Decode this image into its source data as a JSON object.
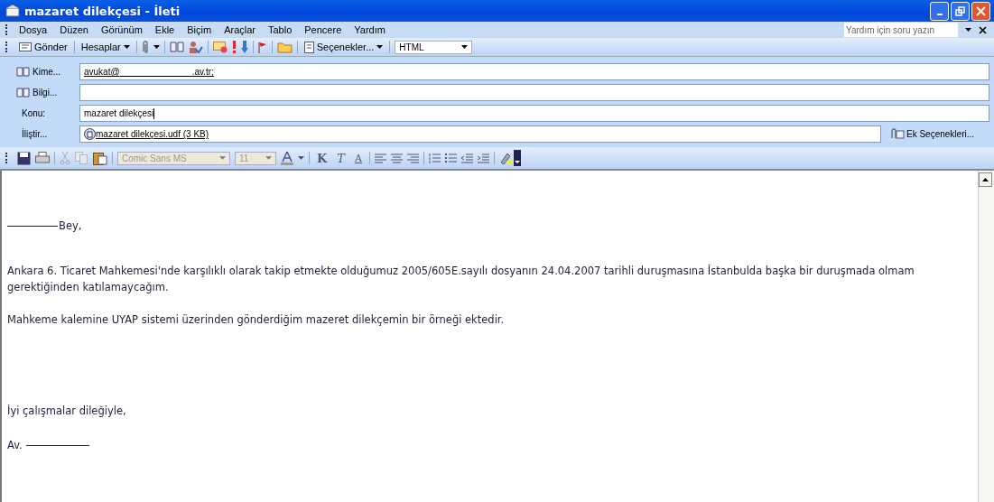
{
  "window": {
    "title": "mazaret dilekçesi - İleti"
  },
  "menu": [
    {
      "label": "Dosya"
    },
    {
      "label": "Düzen"
    },
    {
      "label": "Görünüm"
    },
    {
      "label": "Ekle"
    },
    {
      "label": "Biçim"
    },
    {
      "label": "Araçlar"
    },
    {
      "label": "Tablo"
    },
    {
      "label": "Pencere"
    },
    {
      "label": "Yardım"
    }
  ],
  "help_search": {
    "placeholder": "Yardım için soru yazın"
  },
  "toolbar": {
    "send": "Gönder",
    "accounts": "Hesaplar",
    "options": "Seçenekler...",
    "format": "HTML"
  },
  "fields": [
    {
      "kind": "address",
      "label": "Kime...",
      "value": "avukat@",
      "value_end": ".av.tr;"
    },
    {
      "kind": "address",
      "label": "Bilgi..."
    },
    {
      "kind": "text",
      "label": "Konu:",
      "value": "mazaret dilekçesi"
    },
    {
      "kind": "attachment",
      "label": "İliştir...",
      "value": "mazaret dilekçesi.udf (3 KB)"
    }
  ],
  "attachment_options": "Ek Seçenekleri...",
  "format_toolbar": {
    "font": "Comic Sans MS",
    "size": "11",
    "bold": "K",
    "italic": "T",
    "underline": "A"
  },
  "body": {
    "paragraphs": [
      {
        "kind": "salutation",
        "text": "Bey,"
      },
      {
        "kind": "text",
        "text": "Ankara 6. Ticaret Mahkemesi'nde karşılıklı olarak takip etmekte olduğumuz 2005/605E.sayılı dosyanın 24.04.2007 tarihli duruşmasına İstanbulda başka bir duruşmada olmam gerektiğinden katılamaycağım."
      },
      {
        "kind": "text",
        "text": "Mahkeme kalemine UYAP sistemi üzerinden gönderdiğim mazeret dilekçemin bir örneği ektedir."
      },
      {
        "kind": "text",
        "text": "İyi çalışmalar dileğiyle,"
      },
      {
        "kind": "signature",
        "text": "Av."
      }
    ]
  }
}
